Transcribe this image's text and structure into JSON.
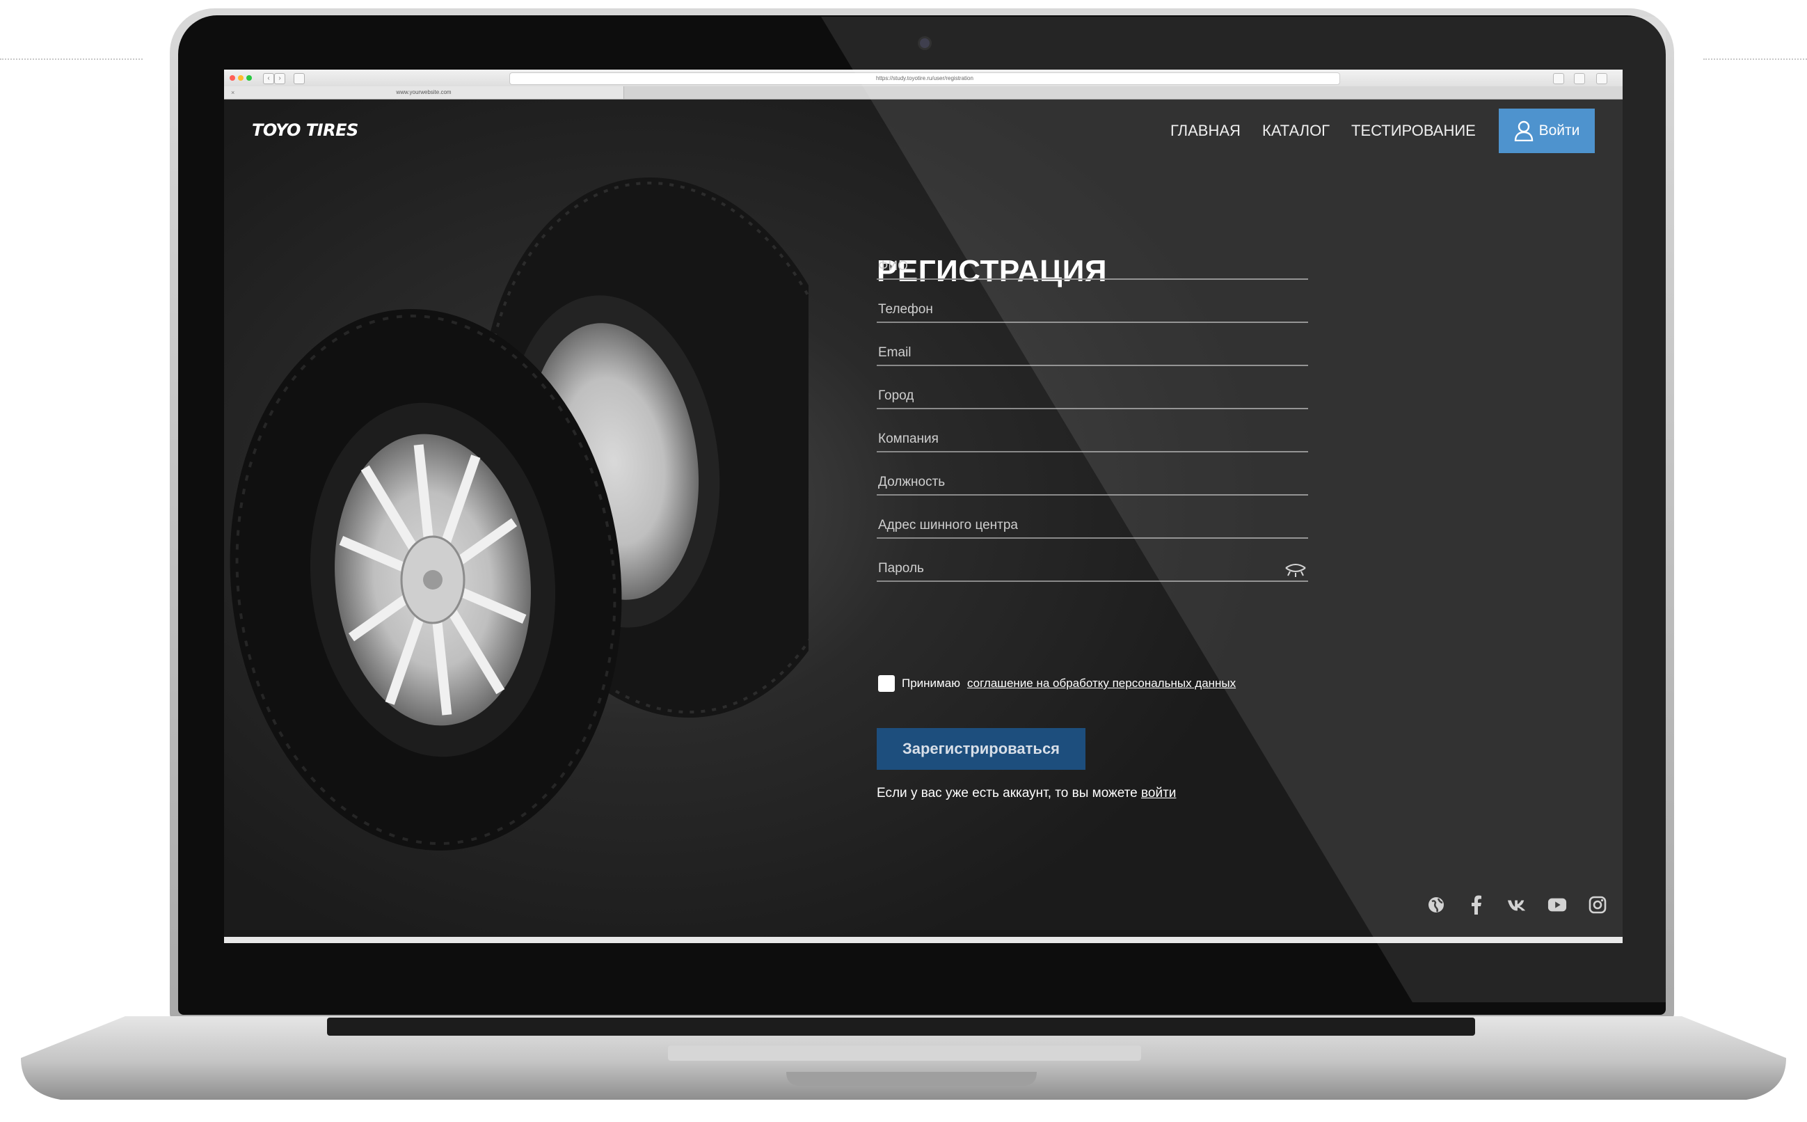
{
  "browser": {
    "url": "https://study.toyotire.ru/user/registration",
    "tab_title": "www.yourwebsite.com",
    "tab_close": "×",
    "back": "‹",
    "forward": "›"
  },
  "header": {
    "logo": "TOYO TIRES",
    "menu": [
      {
        "label": "ГЛАВНАЯ"
      },
      {
        "label": "КАТАЛОГ"
      },
      {
        "label": "ТЕСТИРОВАНИЕ"
      }
    ],
    "login_label": "Войти"
  },
  "form": {
    "title": "РЕГИСТРАЦИЯ",
    "fields": [
      {
        "label": "ФИО"
      },
      {
        "label": "Телефон"
      },
      {
        "label": "Email"
      },
      {
        "label": "Город"
      },
      {
        "label": "Компания"
      },
      {
        "label": "Должность"
      },
      {
        "label": "Адрес шинного центра"
      },
      {
        "label": "Пароль"
      }
    ],
    "agree_prefix": "Принимаю",
    "agree_link": "соглашение на обработку персональных данных",
    "submit_label": "Зарегистрироваться",
    "already_text": "Если у вас уже есть аккаунт, то вы можете",
    "already_link": "войти"
  },
  "socials": [
    {
      "icon": "globe-icon"
    },
    {
      "icon": "facebook-icon"
    },
    {
      "icon": "vk-icon"
    },
    {
      "icon": "youtube-icon"
    },
    {
      "icon": "instagram-icon"
    }
  ],
  "colors": {
    "accent": "#3a87c9",
    "submit": "#1d4e7d",
    "page_bg": "#1b1b1b"
  }
}
